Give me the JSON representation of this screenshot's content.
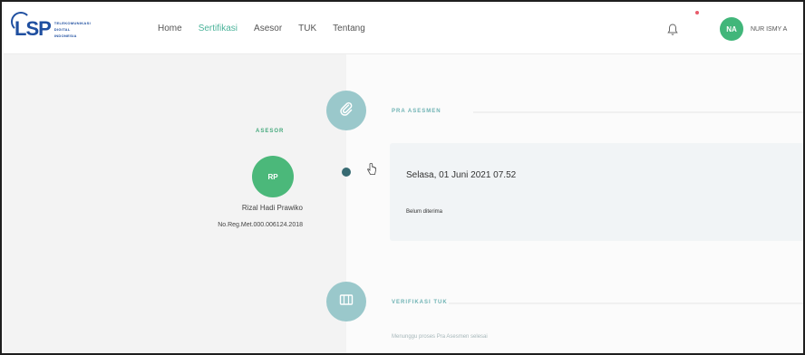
{
  "brand": {
    "logo_text": "LSP",
    "logo_sub": [
      "TELEKOMUNIKASI",
      "DIGITAL",
      "INDONESIA"
    ]
  },
  "nav": {
    "items": [
      {
        "label": "Home",
        "active": false
      },
      {
        "label": "Sertifikasi",
        "active": true
      },
      {
        "label": "Asesor",
        "active": false
      },
      {
        "label": "TUK",
        "active": false
      },
      {
        "label": "Tentang",
        "active": false
      }
    ]
  },
  "user": {
    "initials": "NA",
    "name": "NUR ISMY A"
  },
  "sidebar": {
    "caption": "",
    "asesor_label": "ASESOR",
    "asesor_initials": "RP",
    "asesor_name": "Rizal Hadi Prawiko",
    "asesor_reg": "No.Reg.Met.000.006124.2018"
  },
  "timeline": {
    "step1_label": "PRA ASESMEN",
    "step2_label": "VERIFIKASI TUK",
    "card": {
      "date": "Selasa, 01 Juni 2021 07.52",
      "faded": "",
      "status": "Belum diterima"
    },
    "wait_text": "Menunggu proses Pra Asesmen selesai"
  },
  "colors": {
    "accent": "#4bb39a",
    "avatar_green": "#41b67a",
    "timeline_circle": "#9ac8cb",
    "logo_blue": "#1f4fa0"
  },
  "icons": {
    "notification": "bell-icon",
    "step1": "paperclip-icon",
    "step2": "building-icon",
    "pointer": "hand-cursor-icon"
  }
}
